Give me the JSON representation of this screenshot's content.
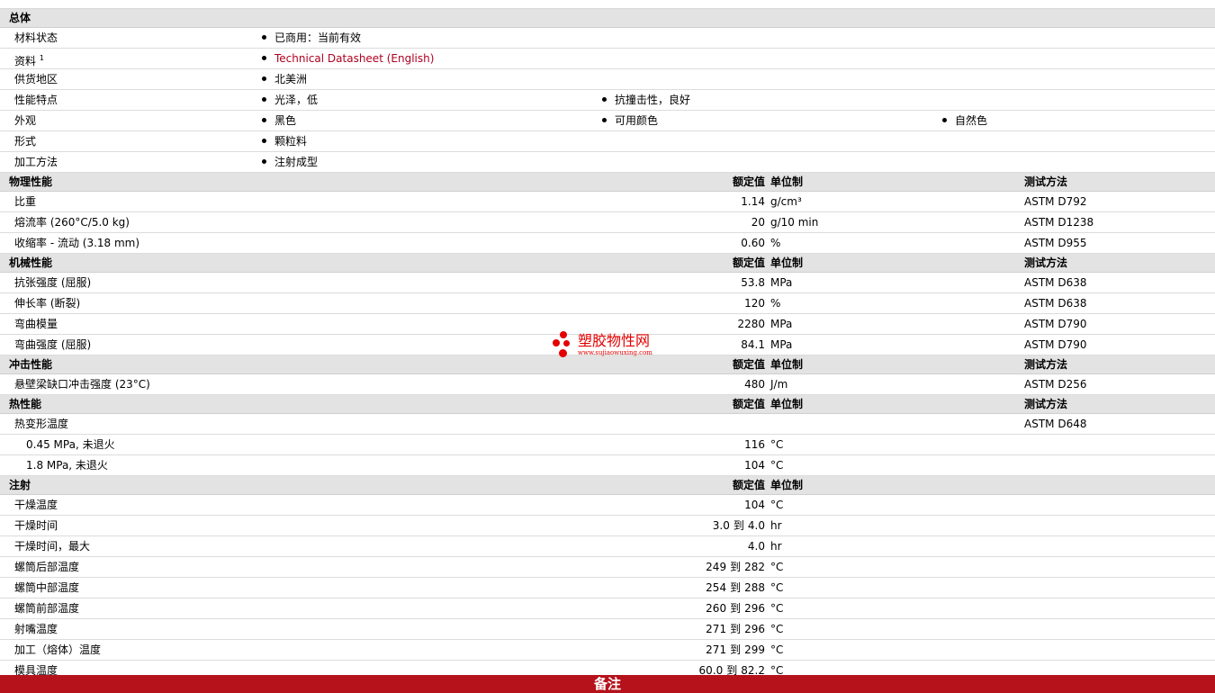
{
  "general": {
    "title": "总体",
    "rows": [
      {
        "label": "材料状态",
        "items": [
          "已商用：当前有效"
        ]
      },
      {
        "label": "资料",
        "sup": "1",
        "items": [
          "Technical Datasheet (English)"
        ],
        "link": true
      },
      {
        "label": "供货地区",
        "items": [
          "北美洲"
        ]
      },
      {
        "label": "性能特点",
        "items": [
          "光泽，低",
          "抗撞击性，良好"
        ]
      },
      {
        "label": "外观",
        "items": [
          "黑色",
          "可用颜色",
          "自然色"
        ]
      },
      {
        "label": "形式",
        "items": [
          "颗粒料"
        ]
      },
      {
        "label": "加工方法",
        "items": [
          "注射成型"
        ]
      }
    ]
  },
  "headers": {
    "rated": "额定值",
    "unit": "单位制",
    "test": "测试方法"
  },
  "physical": {
    "title": "物理性能",
    "rows": [
      {
        "label": "比重",
        "value": "1.14",
        "unit": "g/cm³",
        "test": "ASTM D792"
      },
      {
        "label": "熔流率 (260°C/5.0 kg)",
        "value": "20",
        "unit": "g/10 min",
        "test": "ASTM D1238"
      },
      {
        "label": "收缩率 - 流动 (3.18 mm)",
        "value": "0.60",
        "unit": "%",
        "test": "ASTM D955"
      }
    ]
  },
  "mechanical": {
    "title": "机械性能",
    "rows": [
      {
        "label": "抗张强度 (屈服)",
        "value": "53.8",
        "unit": "MPa",
        "test": "ASTM D638"
      },
      {
        "label": "伸长率 (断裂)",
        "value": "120",
        "unit": "%",
        "test": "ASTM D638"
      },
      {
        "label": "弯曲模量",
        "value": "2280",
        "unit": "MPa",
        "test": "ASTM D790"
      },
      {
        "label": "弯曲强度 (屈服)",
        "value": "84.1",
        "unit": "MPa",
        "test": "ASTM D790"
      }
    ]
  },
  "impact": {
    "title": "冲击性能",
    "rows": [
      {
        "label": "悬壁梁缺口冲击强度 (23°C)",
        "value": "480",
        "unit": "J/m",
        "test": "ASTM D256"
      }
    ]
  },
  "thermal": {
    "title": "热性能",
    "rows": [
      {
        "label": "热变形温度",
        "value": "",
        "unit": "",
        "test": "ASTM D648"
      },
      {
        "label": "0.45 MPa, 未退火",
        "value": "116",
        "unit": "°C",
        "test": "",
        "sub": true
      },
      {
        "label": "1.8 MPa, 未退火",
        "value": "104",
        "unit": "°C",
        "test": "",
        "sub": true
      }
    ]
  },
  "injection": {
    "title": "注射",
    "rows": [
      {
        "label": "干燥温度",
        "value": "104",
        "unit": "°C"
      },
      {
        "label": "干燥时间",
        "from": "3.0",
        "to": "4.0",
        "unit": "hr"
      },
      {
        "label": "干燥时间，最大",
        "value": "4.0",
        "unit": "hr"
      },
      {
        "label": "螺筒后部温度",
        "from": "249",
        "to": "282",
        "unit": "°C"
      },
      {
        "label": "螺筒中部温度",
        "from": "254",
        "to": "288",
        "unit": "°C"
      },
      {
        "label": "螺筒前部温度",
        "from": "260",
        "to": "296",
        "unit": "°C"
      },
      {
        "label": "射嘴温度",
        "from": "271",
        "to": "296",
        "unit": "°C"
      },
      {
        "label": "加工（熔体）温度",
        "from": "271",
        "to": "299",
        "unit": "°C"
      },
      {
        "label": "模具温度",
        "from": "60.0",
        "to": "82.2",
        "unit": "°C"
      }
    ],
    "to_word": "到"
  },
  "footer": {
    "title": "备注"
  },
  "watermark": {
    "name": "塑胶物性网",
    "url": "www.sujiaowuxing.com"
  }
}
